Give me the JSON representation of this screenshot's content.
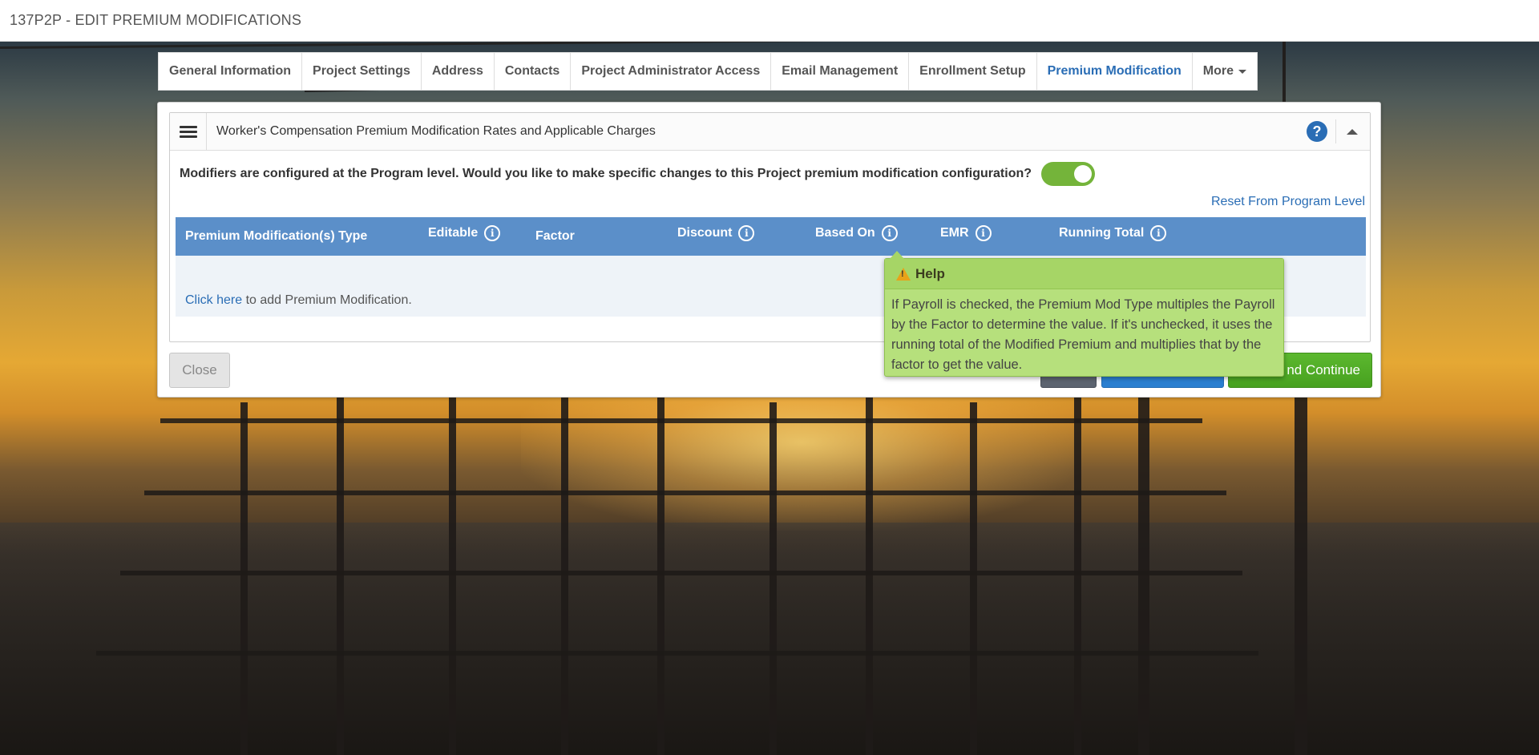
{
  "page": {
    "title": "137P2P - EDIT PREMIUM MODIFICATIONS"
  },
  "tabs": [
    {
      "label": "General Information",
      "active": false
    },
    {
      "label": "Project Settings",
      "active": false
    },
    {
      "label": "Address",
      "active": false
    },
    {
      "label": "Contacts",
      "active": false
    },
    {
      "label": "Project Administrator Access",
      "active": false
    },
    {
      "label": "Email Management",
      "active": false
    },
    {
      "label": "Enrollment Setup",
      "active": false
    },
    {
      "label": "Premium Modification",
      "active": true
    },
    {
      "label": "More",
      "active": false
    }
  ],
  "panel": {
    "title": "Worker's Compensation Premium Modification Rates and Applicable Charges",
    "help_icon": "question-circle-icon",
    "collapse_icon": "chevron-up-icon",
    "question": "Modifiers are configured at the Program level. Would you like to make specific changes to this Project premium modification configuration?",
    "toggle_on": true,
    "reset_link": "Reset From Program Level"
  },
  "table": {
    "columns": [
      {
        "label": "Premium Modification(s) Type",
        "info": false
      },
      {
        "label": "Editable",
        "info": true
      },
      {
        "label": "Factor",
        "info": false
      },
      {
        "label": "Discount",
        "info": true
      },
      {
        "label": "Based On",
        "info": true
      },
      {
        "label": "EMR",
        "info": true
      },
      {
        "label": "Running Total",
        "info": true
      }
    ],
    "empty": {
      "link": "Click here",
      "text": " to add Premium Modification."
    }
  },
  "buttons": {
    "close": "Close",
    "save_continue": "nd Continue"
  },
  "tooltip": {
    "title": "Help",
    "body": "If Payroll is checked, the Premium Mod Type multiples the Payroll by the Factor to determine the value. If it's unchecked, it uses the running total of the Modified Premium and multiplies that by the factor to get the value."
  },
  "colors": {
    "accent_blue": "#2a6db5",
    "table_header": "#5b8fc9",
    "toggle_green": "#74b43a",
    "tooltip_green": "#b6e07c"
  }
}
